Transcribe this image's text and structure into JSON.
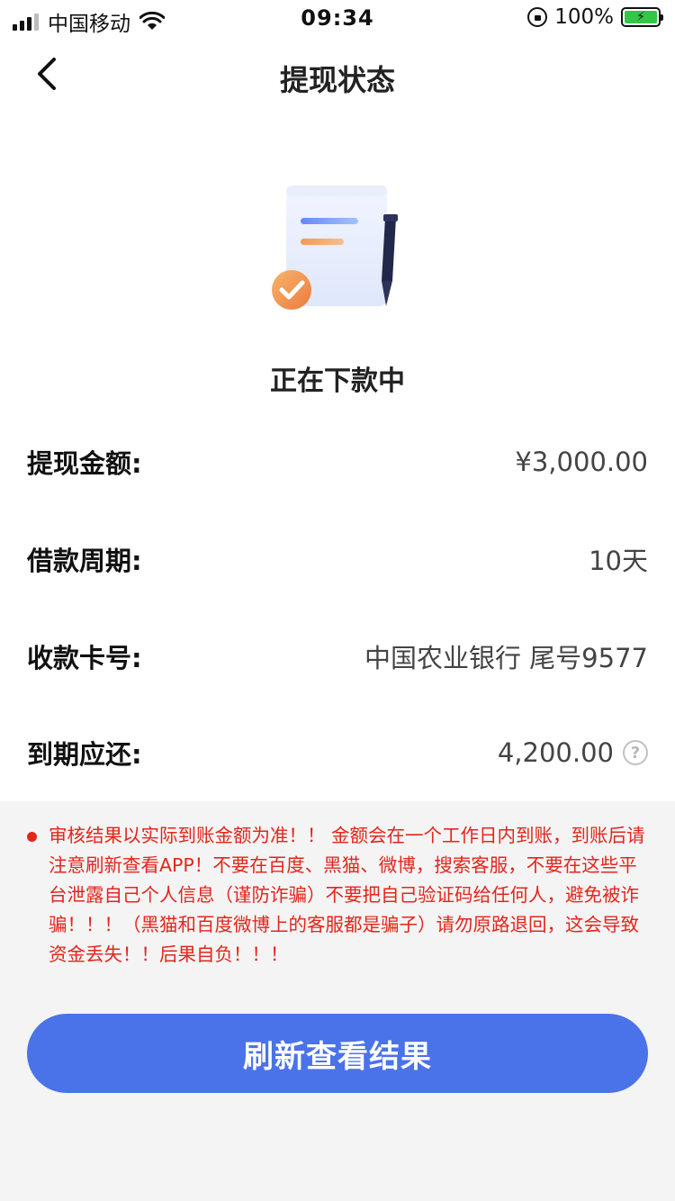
{
  "status_bar": {
    "carrier": "中国移动",
    "time": "09:34",
    "battery": "100%"
  },
  "nav": {
    "title": "提现状态"
  },
  "status": {
    "text": "正在下款中"
  },
  "rows": [
    {
      "label": "提现金额:",
      "value": "¥3,000.00"
    },
    {
      "label": "借款周期:",
      "value": "10天"
    },
    {
      "label": "收款卡号:",
      "value": "中国农业银行 尾号9577"
    },
    {
      "label": "到期应还:",
      "value": "4,200.00"
    }
  ],
  "help_icon_glyph": "?",
  "notice": {
    "text": "审核结果以实际到账金额为准！！ 金额会在一个工作日内到账，到账后请注意刷新查看APP！不要在百度、黑猫、微博，搜索客服，不要在这些平台泄露自己个人信息（谨防诈骗）不要把自己验证码给任何人，避免被诈骗！！！（黑猫和百度微博上的客服都是骗子）请勿原路退回，这会导致资金丢失！！后果自负！！！",
    "color": "#e3261c"
  },
  "button": {
    "label": "刷新查看结果",
    "color": "#4a73e9"
  }
}
